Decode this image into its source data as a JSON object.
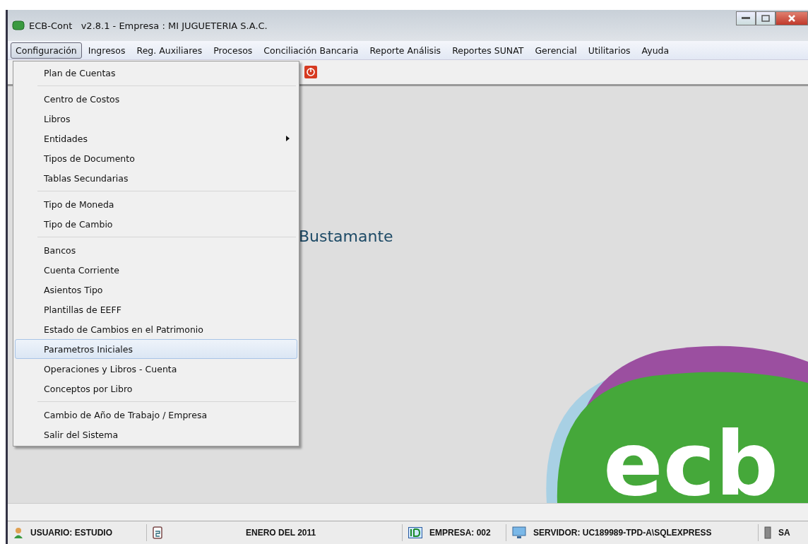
{
  "window": {
    "title": "ECB-Cont   v2.8.1 - Empresa : MI JUGUETERIA S.A.C."
  },
  "menu_bar": [
    {
      "label": "Configuración",
      "selected": true
    },
    {
      "label": "Ingresos",
      "selected": false
    },
    {
      "label": "Reg. Auxiliares",
      "selected": false
    },
    {
      "label": "Procesos",
      "selected": false
    },
    {
      "label": "Conciliación Bancaria",
      "selected": false
    },
    {
      "label": "Reporte Análisis",
      "selected": false
    },
    {
      "label": "Reportes SUNAT",
      "selected": false
    },
    {
      "label": "Gerencial",
      "selected": false
    },
    {
      "label": "Utilitarios",
      "selected": false
    },
    {
      "label": "Ayuda",
      "selected": false
    }
  ],
  "dropdown": {
    "groups": [
      [
        {
          "label": "Plan de Cuentas",
          "selected": false,
          "submenu": false
        }
      ],
      [
        {
          "label": "Centro de Costos",
          "selected": false,
          "submenu": false
        },
        {
          "label": "Libros",
          "selected": false,
          "submenu": false
        },
        {
          "label": "Entidades",
          "selected": false,
          "submenu": true
        },
        {
          "label": "Tipos de Documento",
          "selected": false,
          "submenu": false
        },
        {
          "label": "Tablas Secundarias",
          "selected": false,
          "submenu": false
        }
      ],
      [
        {
          "label": "Tipo de Moneda",
          "selected": false,
          "submenu": false
        },
        {
          "label": "Tipo de Cambio",
          "selected": false,
          "submenu": false
        }
      ],
      [
        {
          "label": "Bancos",
          "selected": false,
          "submenu": false
        },
        {
          "label": "Cuenta Corriente",
          "selected": false,
          "submenu": false
        },
        {
          "label": "Asientos Tipo",
          "selected": false,
          "submenu": false
        },
        {
          "label": "Plantillas de EEFF",
          "selected": false,
          "submenu": false
        },
        {
          "label": "Estado de Cambios en el Patrimonio",
          "selected": false,
          "submenu": false
        },
        {
          "label": "Parametros Iniciales",
          "selected": true,
          "submenu": false
        },
        {
          "label": "Operaciones y Libros - Cuenta",
          "selected": false,
          "submenu": false
        },
        {
          "label": "Conceptos por Libro",
          "selected": false,
          "submenu": false
        }
      ],
      [
        {
          "label": "Cambio de Año de Trabajo / Empresa",
          "selected": false,
          "submenu": false
        },
        {
          "label": "Salir del Sistema",
          "selected": false,
          "submenu": false
        }
      ]
    ]
  },
  "background": {
    "name_text": "Bustamante",
    "logo_text": "ecb"
  },
  "status_bar": [
    {
      "kind": "user",
      "text": "USUARIO: ESTUDIO"
    },
    {
      "kind": "date",
      "text": "ENERO DEL 2011"
    },
    {
      "kind": "company",
      "text": "EMPRESA: 002"
    },
    {
      "kind": "server",
      "text": "SERVIDOR: UC189989-TPD-A\\SQLEXPRESS"
    },
    {
      "kind": "other",
      "text": "SA"
    }
  ]
}
